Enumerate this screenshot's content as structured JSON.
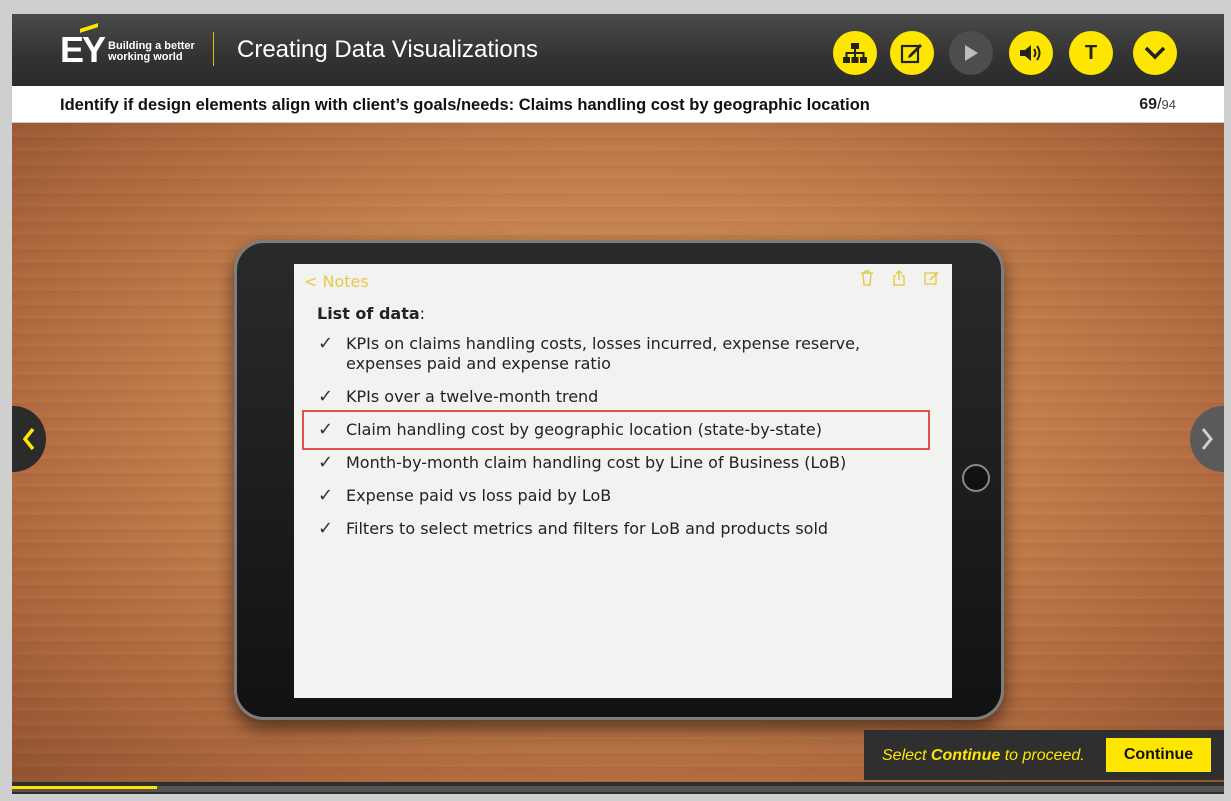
{
  "header": {
    "logo_mark": "EY",
    "logo_tagline_1": "Building a better",
    "logo_tagline_2": "working world",
    "course_title": "Creating Data Visualizations",
    "buttons": [
      {
        "name": "menu-button",
        "icon": "sitemap-icon"
      },
      {
        "name": "notes-button",
        "icon": "edit-icon"
      },
      {
        "name": "play-button",
        "icon": "play-icon"
      },
      {
        "name": "audio-button",
        "icon": "speaker-icon"
      },
      {
        "name": "transcript-button",
        "icon": "T",
        "label": "T"
      },
      {
        "name": "collapse-button",
        "icon": "chevron-down-icon"
      }
    ]
  },
  "titlebar": {
    "slide_title": "Identify if design elements align with client’s goals/needs: Claims handling cost by geographic location",
    "current_page": "69",
    "separator": "/",
    "total_pages": "94"
  },
  "tablet": {
    "nav_back": "< Notes",
    "list_heading": "List of data",
    "list_colon": ":",
    "items": [
      {
        "text": "KPIs on claims handling costs, losses incurred, expense reserve,",
        "text2": "expenses paid and expense ratio",
        "highlighted": false
      },
      {
        "text": "KPIs over a twelve-month trend",
        "highlighted": false
      },
      {
        "text": "Claim handling cost by geographic location (state-by-state)",
        "highlighted": true
      },
      {
        "text": "Month-by-month claim handling cost by Line of Business (LoB)",
        "highlighted": false
      },
      {
        "text": "Expense paid vs loss paid by LoB",
        "highlighted": false
      },
      {
        "text": "Filters to select metrics and filters for LoB and products sold",
        "highlighted": false
      }
    ]
  },
  "footer": {
    "prompt_prefix": "Select ",
    "prompt_bold": "Continue",
    "prompt_suffix": " to proceed.",
    "continue_label": "Continue",
    "progress_fraction": 0.12
  },
  "colors": {
    "accent": "#ffe600",
    "highlight_border": "#d9534f",
    "header_bg": "#333333"
  }
}
